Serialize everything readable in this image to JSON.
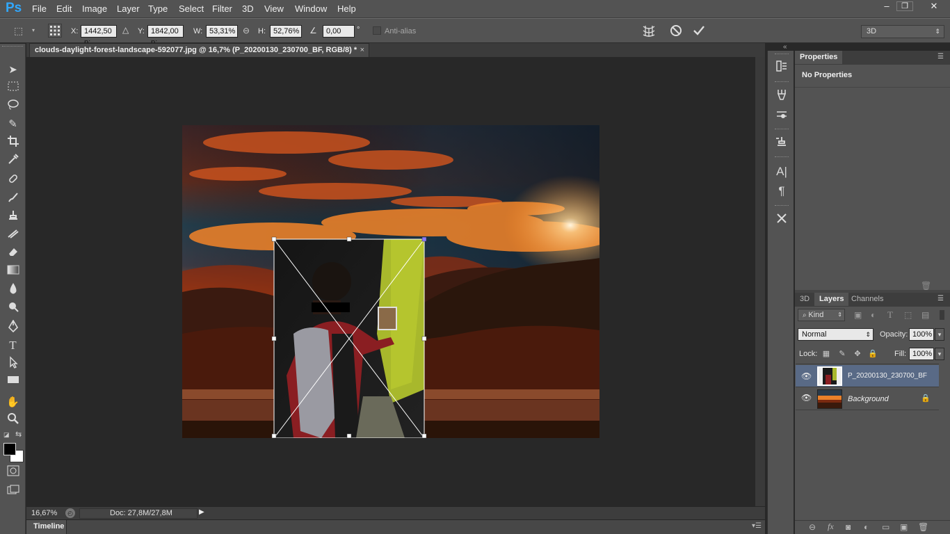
{
  "app": {
    "logo": "Ps"
  },
  "menu": [
    "File",
    "Edit",
    "Image",
    "Layer",
    "Type",
    "Select",
    "Filter",
    "3D",
    "View",
    "Window",
    "Help"
  ],
  "window_controls": {
    "minimize": "–",
    "restore": "❐",
    "close": "✕"
  },
  "options": {
    "x_label": "X:",
    "x_value": "1442,50 p:",
    "y_label": "Y:",
    "y_value": "1842,00 p:",
    "w_label": "W:",
    "w_value": "53,31%",
    "h_label": "H:",
    "h_value": "52,76%",
    "angle_value": "0,00",
    "degree_sign": "°",
    "antialias_label": "Anti-alias",
    "workspace": "3D"
  },
  "document": {
    "tab_title": "clouds-daylight-forest-landscape-592077.jpg @ 16,7% (P_20200130_230700_BF, RGB/8) *",
    "close": "×"
  },
  "status": {
    "zoom": "16,67%",
    "doc": "Doc: 27,8M/27,8M"
  },
  "timeline": {
    "label": "Timeline"
  },
  "properties": {
    "tab": "Properties",
    "no_props": "No Properties"
  },
  "layers_panel": {
    "tabs": [
      "3D",
      "Layers",
      "Channels"
    ],
    "filter_kind": "Kind",
    "blend_mode": "Normal",
    "opacity_label": "Opacity:",
    "opacity_value": "100%",
    "lock_label": "Lock:",
    "fill_label": "Fill:",
    "fill_value": "100%",
    "layers": [
      {
        "name": "P_20200130_230700_BF",
        "selected": true
      },
      {
        "name": "Background",
        "selected": false
      }
    ]
  },
  "colors": {
    "accent": "#31a8ff",
    "selected_layer": "#596a86"
  }
}
